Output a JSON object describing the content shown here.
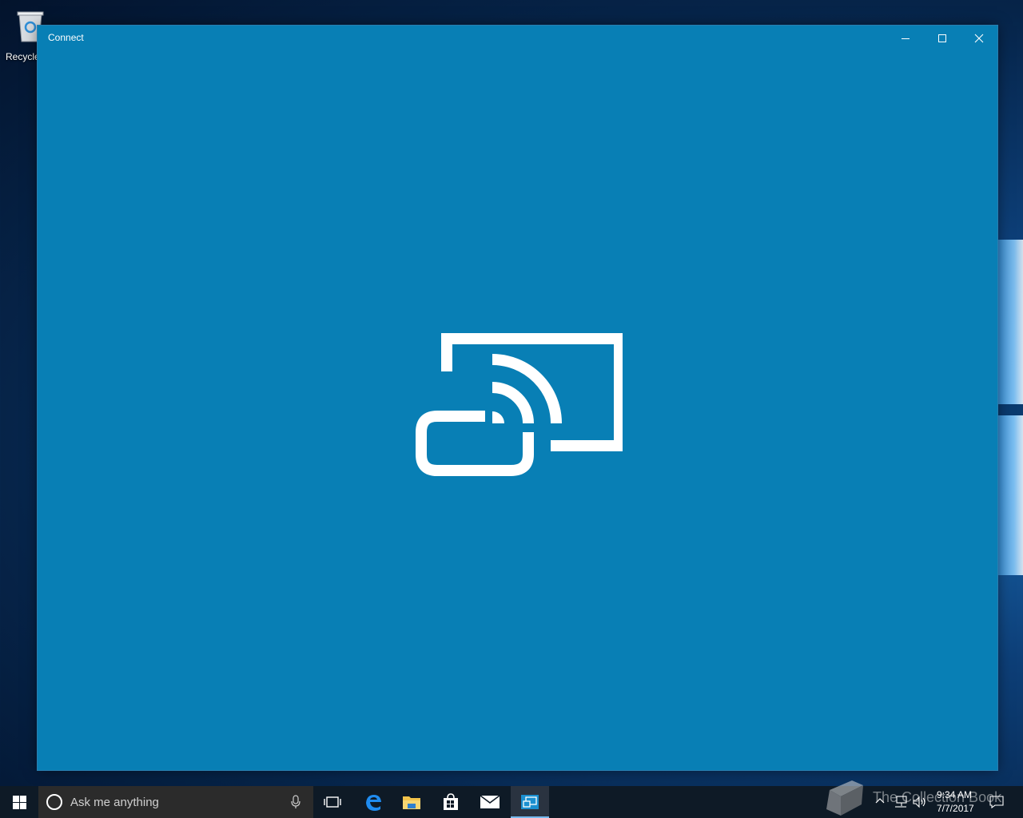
{
  "desktop": {
    "icons": [
      {
        "label": "Recycle",
        "icon": "recycle-bin-icon"
      }
    ]
  },
  "window": {
    "title": "Connect",
    "controls": {
      "minimize": "minimize-icon",
      "maximize": "maximize-icon",
      "close": "close-icon"
    },
    "content_icon": "project-cast-icon",
    "background_color": "#087fb5"
  },
  "taskbar": {
    "search_placeholder": "Ask me anything",
    "apps": [
      {
        "name": "Task View",
        "icon": "task-view-icon",
        "active": false
      },
      {
        "name": "Microsoft Edge",
        "icon": "edge-icon",
        "active": false
      },
      {
        "name": "File Explorer",
        "icon": "folder-icon",
        "active": false
      },
      {
        "name": "Store",
        "icon": "store-icon",
        "active": false
      },
      {
        "name": "Mail",
        "icon": "mail-icon",
        "active": false
      },
      {
        "name": "Connect",
        "icon": "connect-icon",
        "active": true
      }
    ],
    "clock": {
      "time": "9:34 AM",
      "date": "7/7/2017"
    }
  },
  "watermark": {
    "text": "The Collection Book"
  }
}
